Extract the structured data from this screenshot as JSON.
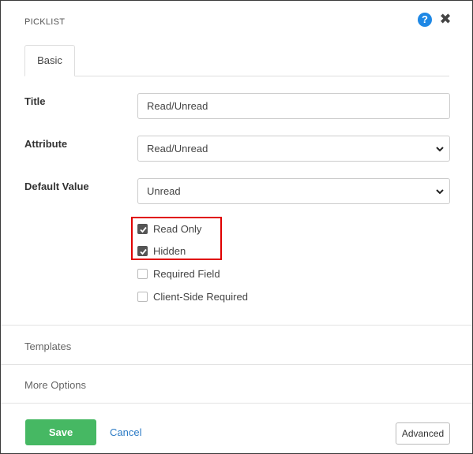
{
  "dialog": {
    "title": "PICKLIST",
    "help_icon": "question-circle-icon",
    "help_glyph": "?",
    "close_icon": "close-icon",
    "close_glyph": "✖"
  },
  "tabs": [
    {
      "label": "Basic",
      "active": true
    }
  ],
  "form": {
    "title_label": "Title",
    "title_value": "Read/Unread",
    "attribute_label": "Attribute",
    "attribute_value": "Read/Unread",
    "default_label": "Default Value",
    "default_value": "Unread"
  },
  "checkboxes": [
    {
      "label": "Read Only",
      "checked": true
    },
    {
      "label": "Hidden",
      "checked": true
    },
    {
      "label": "Required Field",
      "checked": false
    },
    {
      "label": "Client-Side Required",
      "checked": false
    }
  ],
  "sections": {
    "templates": "Templates",
    "more_options": "More Options"
  },
  "footer": {
    "save_label": "Save",
    "cancel_label": "Cancel",
    "advanced_label": "Advanced"
  },
  "colors": {
    "save": "#46b863",
    "link": "#2c7bc5",
    "highlight": "#e00000",
    "help": "#1e88e5"
  }
}
